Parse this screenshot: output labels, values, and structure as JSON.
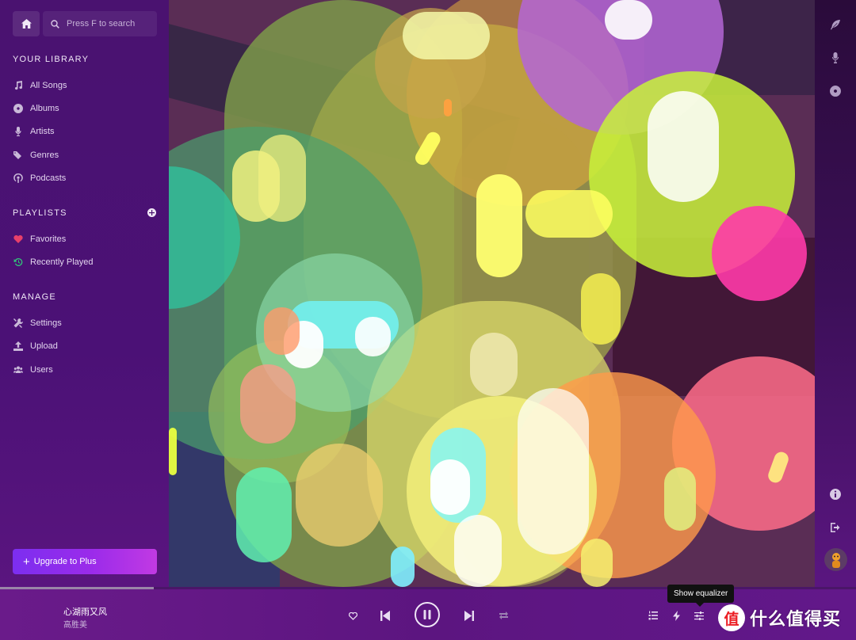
{
  "sidebar": {
    "search_placeholder": "Press F to search",
    "library_title": "YOUR LIBRARY",
    "library_items": [
      {
        "label": "All Songs",
        "icon": "music-note-icon"
      },
      {
        "label": "Albums",
        "icon": "disc-icon"
      },
      {
        "label": "Artists",
        "icon": "microphone-icon"
      },
      {
        "label": "Genres",
        "icon": "tags-icon"
      },
      {
        "label": "Podcasts",
        "icon": "podcast-icon"
      }
    ],
    "playlists_title": "PLAYLISTS",
    "playlist_items": [
      {
        "label": "Favorites",
        "icon": "heart-icon",
        "icon_color": "#e8406a"
      },
      {
        "label": "Recently Played",
        "icon": "history-icon",
        "icon_color": "#33c07a"
      }
    ],
    "manage_title": "MANAGE",
    "manage_items": [
      {
        "label": "Settings",
        "icon": "tools-icon"
      },
      {
        "label": "Upload",
        "icon": "upload-icon"
      },
      {
        "label": "Users",
        "icon": "users-icon"
      }
    ],
    "upgrade_label": "Upgrade to Plus"
  },
  "player": {
    "title": "心湖雨又风",
    "artist": "高胜美",
    "progress": 0.18,
    "tooltip": "Show equalizer"
  },
  "watermark": {
    "badge": "值",
    "text": "什么值得买"
  },
  "colors": {
    "sidebar_bg": "#4a1270",
    "accent": "#8b2df0",
    "player_bar": "#6a1b8a",
    "favorites_heart": "#e8406a",
    "recently_played": "#33c07a"
  }
}
